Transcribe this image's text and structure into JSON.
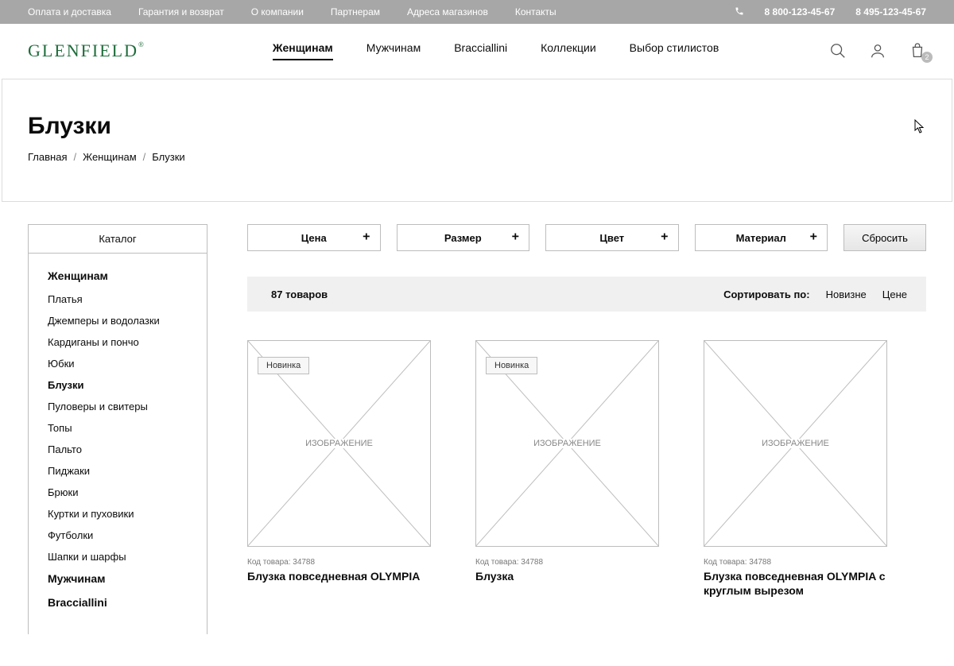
{
  "topLinks": [
    "Оплата и доставка",
    "Гарантия и возврат",
    "О компании",
    "Партнерам",
    "Адреса магазинов",
    "Контакты"
  ],
  "phones": [
    "8 800-123-45-67",
    "8 495-123-45-67"
  ],
  "logo": "GLENFIELD",
  "nav": {
    "items": [
      "Женщинам",
      "Мужчинам",
      "Bracciallini",
      "Коллекции",
      "Выбор стилистов"
    ],
    "active": "Женщинам"
  },
  "cartCount": "2",
  "page": {
    "title": "Блузки"
  },
  "breadcrumb": [
    {
      "t": "Главная",
      "link": true
    },
    {
      "t": "Женщинам",
      "link": true
    },
    {
      "t": "Блузки",
      "link": false
    }
  ],
  "sidebar": {
    "title": "Каталог",
    "groups": [
      {
        "title": "Женщинам",
        "items": [
          "Платья",
          "Джемперы и водолазки",
          "Кардиганы и пончо",
          "Юбки",
          "Блузки",
          "Пуловеры и свитеры",
          "Топы",
          "Пальто",
          "Пиджаки",
          "Брюки",
          "Куртки и пуховики",
          "Футболки",
          "Шапки и шарфы"
        ],
        "active": "Блузки"
      },
      {
        "title": "Мужчинам",
        "items": []
      },
      {
        "title": "Bracciallini",
        "items": []
      }
    ]
  },
  "filters": [
    "Цена",
    "Размер",
    "Цвет",
    "Материал"
  ],
  "resetLabel": "Сбросить",
  "toolbar": {
    "count": "87 товаров",
    "sortLabel": "Сортировать по:",
    "sortOptions": [
      "Новизне",
      "Цене"
    ]
  },
  "imagePlaceholder": "ИЗОБРАЖЕНИЕ",
  "badgeNew": "Новинка",
  "skuPrefix": "Код товара: ",
  "products": [
    {
      "sku": "34788",
      "name": "Блузка повседневная OLYMPIA",
      "badge": true
    },
    {
      "sku": "34788",
      "name": "Блузка",
      "badge": true
    },
    {
      "sku": "34788",
      "name": "Блузка повседневная OLYMPIA с круглым вырезом",
      "badge": false
    }
  ]
}
